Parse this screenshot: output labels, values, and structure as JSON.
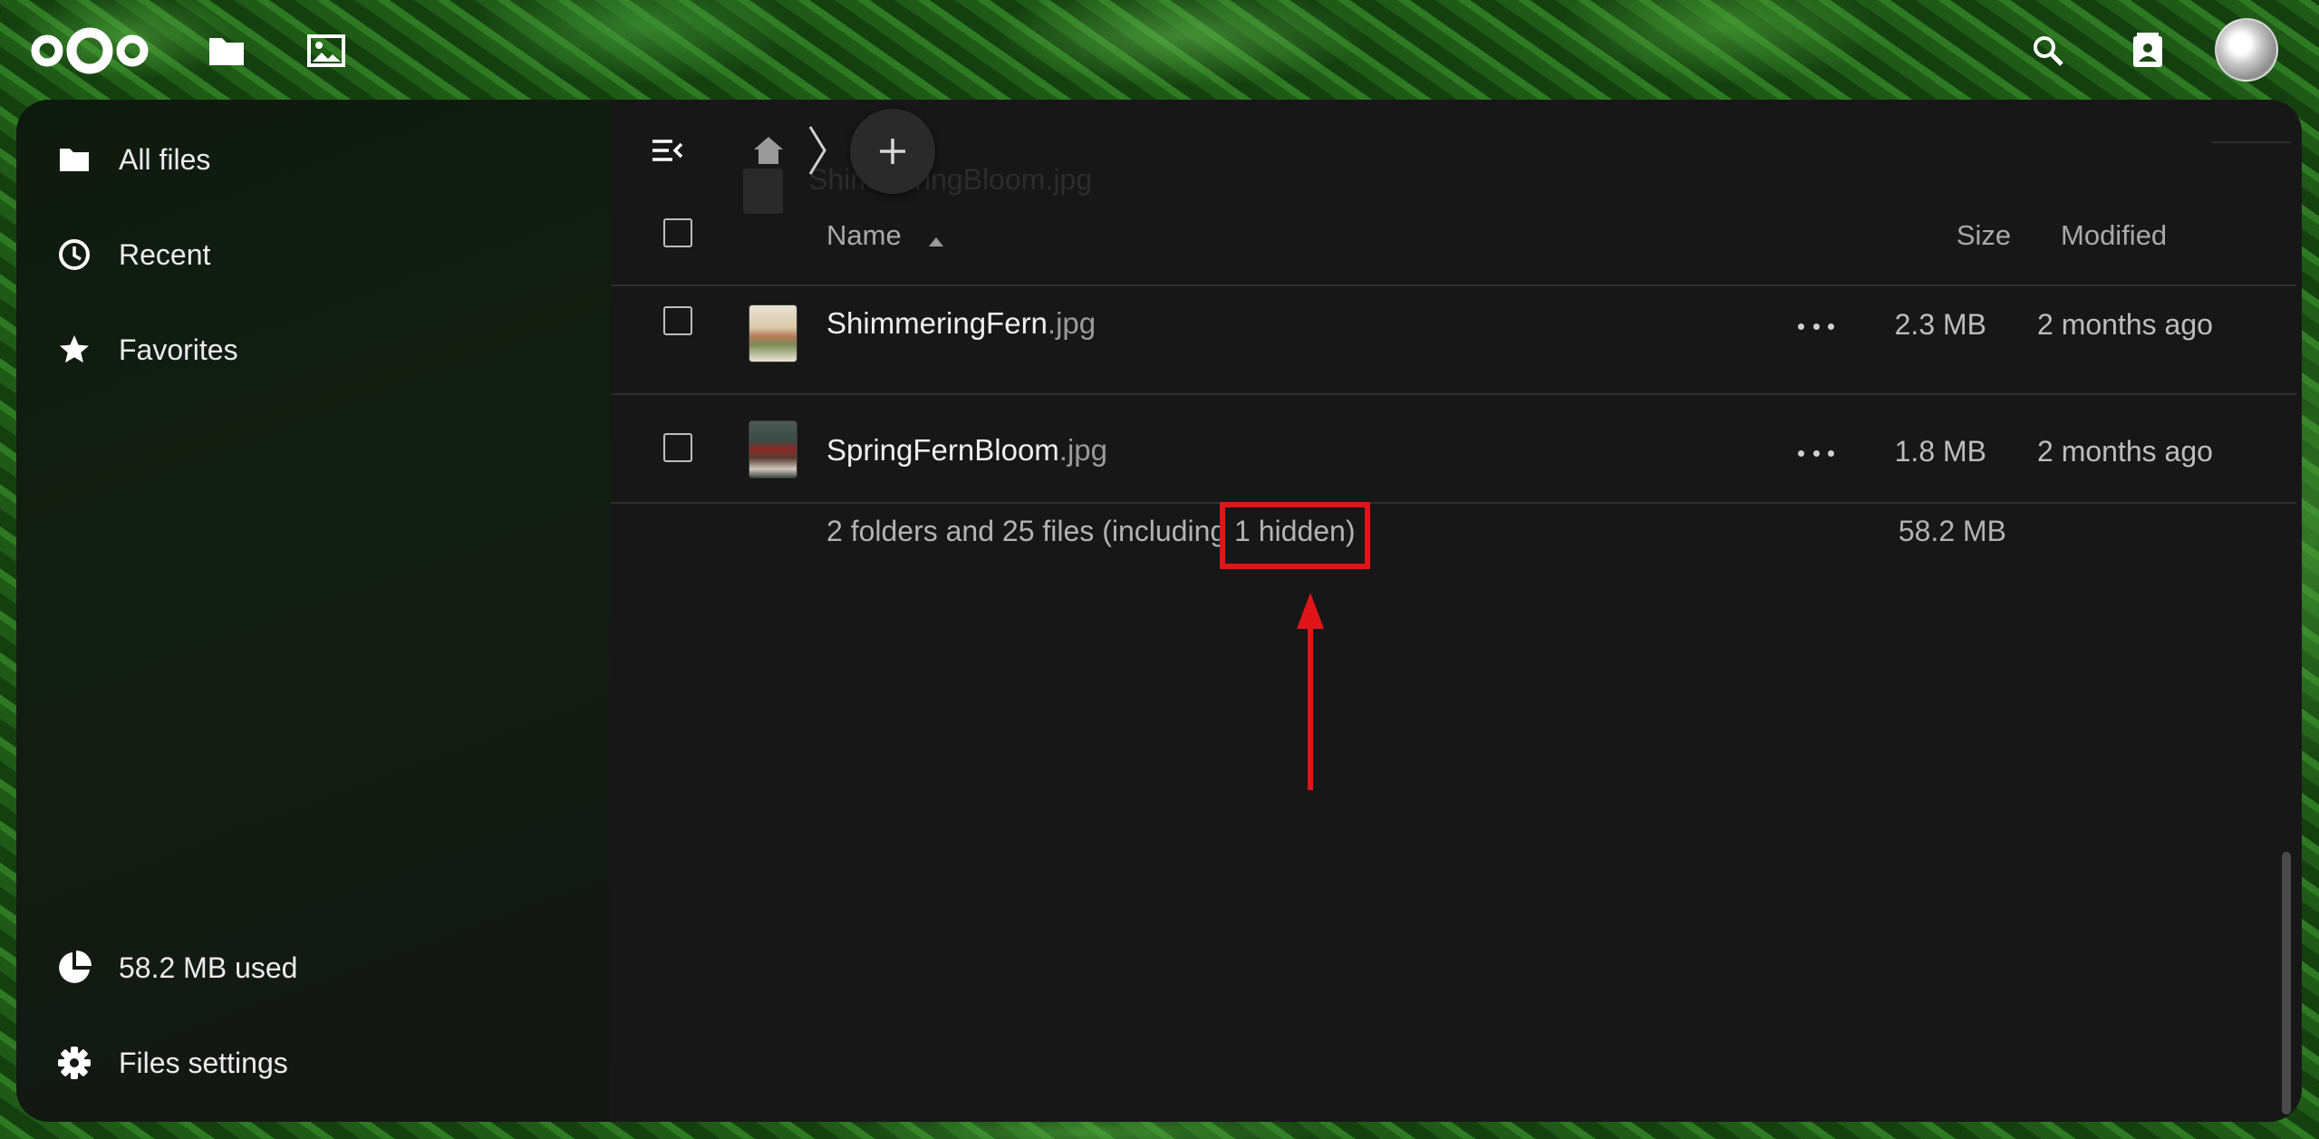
{
  "header": {
    "logo": "nextcloud-logo",
    "apps": [
      {
        "name": "files-app-icon",
        "label": "Files"
      },
      {
        "name": "photos-app-icon",
        "label": "Photos"
      }
    ],
    "right_icons": [
      "search-icon",
      "contacts-icon"
    ],
    "avatar": "user-avatar"
  },
  "sidebar": {
    "items": [
      {
        "label": "All files",
        "icon": "folder-icon"
      },
      {
        "label": "Recent",
        "icon": "clock-icon"
      },
      {
        "label": "Favorites",
        "icon": "star-icon"
      }
    ],
    "footer": [
      {
        "label": "58.2 MB used",
        "icon": "pie-chart-icon"
      },
      {
        "label": "Files settings",
        "icon": "gear-icon"
      }
    ]
  },
  "toolbar": {
    "toggle_icon": "sidebar-toggle-icon",
    "home_icon": "home-icon",
    "chevron_icon": "chevron-right-icon",
    "new_icon": "plus-icon",
    "ghost_filename": "ShimmeringBloom.jpg"
  },
  "table": {
    "headers": {
      "name": "Name",
      "size": "Size",
      "modified": "Modified"
    },
    "rows": [
      {
        "basename": "ShimmeringFern",
        "ext": ".jpg",
        "size": "2.3 MB",
        "modified": "2 months ago"
      },
      {
        "basename": "SpringFernBloom",
        "ext": ".jpg",
        "size": "1.8 MB",
        "modified": "2 months ago"
      }
    ],
    "summary": "2 folders and 25 files (including 1 hidden)",
    "summary_size": "58.2 MB"
  },
  "colors": {
    "panel_bg": "#171717",
    "annotation": "#e0151a",
    "text": "#efefef"
  }
}
